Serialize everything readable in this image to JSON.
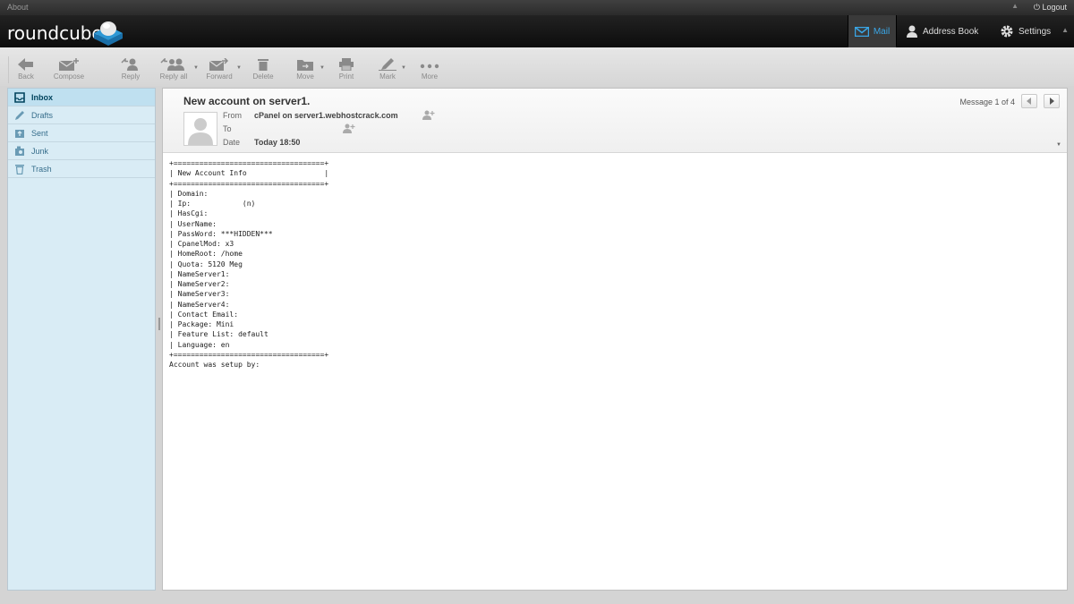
{
  "topbar": {
    "about": "About",
    "logout": "Logout"
  },
  "header": {
    "logo": "roundcube",
    "nav": {
      "mail": "Mail",
      "address_book": "Address Book",
      "settings": "Settings"
    }
  },
  "toolbar": {
    "back": "Back",
    "compose": "Compose",
    "reply": "Reply",
    "reply_all": "Reply all",
    "forward": "Forward",
    "delete": "Delete",
    "move": "Move",
    "print": "Print",
    "mark": "Mark",
    "more": "More"
  },
  "folders": [
    {
      "label": "Inbox",
      "icon": "inbox-icon",
      "active": true
    },
    {
      "label": "Drafts",
      "icon": "pencil-icon"
    },
    {
      "label": "Sent",
      "icon": "sent-icon"
    },
    {
      "label": "Junk",
      "icon": "junk-icon"
    },
    {
      "label": "Trash",
      "icon": "trash-icon"
    }
  ],
  "message": {
    "subject": "New account on server1.",
    "from_label": "From",
    "from": "cPanel on server1.webhostcrack.com",
    "to_label": "To",
    "to": "",
    "date_label": "Date",
    "date": "Today 18:50",
    "counter": "Message 1 of 4",
    "body": "+===================================+\n| New Account Info                  |\n+===================================+\n| Domain: \n| Ip:            (n)\n| HasCgi: \n| UserName: \n| PassWord: ***HIDDEN***\n| CpanelMod: x3\n| HomeRoot: /home\n| Quota: 5120 Meg\n| NameServer1: \n| NameServer2: \n| NameServer3: \n| NameServer4: \n| Contact Email: \n| Package: Mini\n| Feature List: default\n| Language: en\n+===================================+\nAccount was setup by: "
  },
  "colors": {
    "accent": "#3aa6e6",
    "folder_bg": "#d9ecf5",
    "active_folder": "#bfe0f0"
  }
}
